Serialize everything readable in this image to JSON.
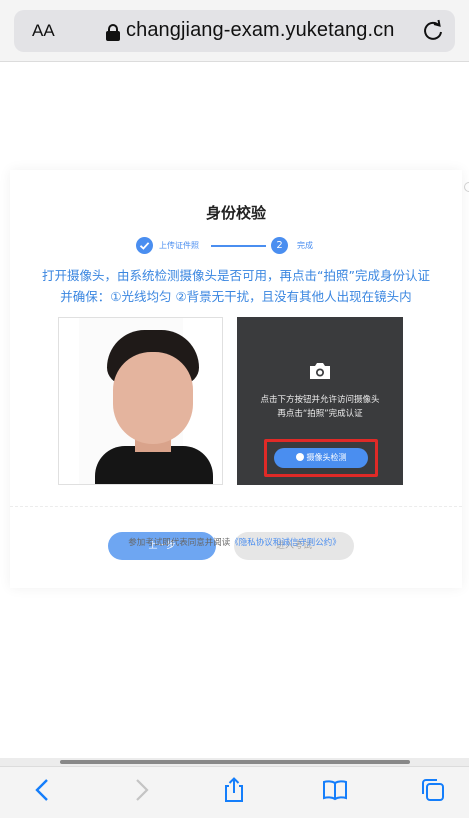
{
  "browser": {
    "text_size_label": "AA",
    "url": "changjiang-exam.yuketang.cn",
    "icons": [
      "lock-icon",
      "reload-icon",
      "back-icon",
      "forward-icon",
      "share-icon",
      "bookmarks-icon",
      "tabs-icon"
    ],
    "accent": "#147efb"
  },
  "verification": {
    "title": "身份校验",
    "steps": [
      {
        "label": "上传证件照",
        "status": "done"
      },
      {
        "number": "2",
        "label": "完成",
        "status": "current"
      }
    ],
    "instruction_line1": "打开摄像头，由系统检测摄像头是否可用，再点击“拍照”完成身份认证",
    "instruction_line2": "并确保：①光线均匀 ②背景无干扰，且没有其他人出现在镜头内",
    "camera_hint_line1": "点击下方按钮并允许访问摄像头",
    "camera_hint_line2": "再点击“拍照”完成认证",
    "detect_button": "摄像头检测",
    "prev_button": "上一步",
    "enter_button": "进入考试",
    "agreement_prefix": "参加考试即代表同意并阅读",
    "agreement_link": "《隐私协议和诚信守则公约》"
  },
  "colors": {
    "primary": "#4a8ef0",
    "highlight_box": "#e02a27",
    "camera_bg": "#3a3b3d"
  }
}
